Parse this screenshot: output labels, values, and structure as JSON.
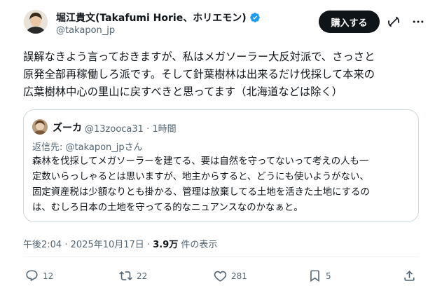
{
  "author": {
    "name": "堀江貴文(Takafumi Horie、ホリエモン)",
    "handle": "@takapon_jp",
    "subscribe_label": "購入する"
  },
  "post": {
    "lines": [
      "誤解なきよう言っておきますが、私はメガソーラー大反対派で、さっさと",
      "原発全部再稼働しろ派です。そして針葉樹林は出来るだけ伐採して本来の",
      "広葉樹林中心の里山に戻すべきと思ってます（北海道などは除く）"
    ]
  },
  "quote": {
    "name": "ズーカ",
    "handle": "@13zooca31",
    "separator": "·",
    "time": "1時間",
    "reply_prefix": "返信先: ",
    "reply_handle": "@takapon_jp",
    "reply_suffix": "さん",
    "lines": [
      "森林を伐採してメガソーラーを建てる、要は自然を守ってないって考えの人も一",
      "定数いらっしゃるとは思いますが、地主からすると、どうにも使いようがない、",
      "固定資産税は少額なりとも掛かる、管理は放棄してる土地を活きた土地にするの",
      "は、むしろ日本の土地を守ってる的なニュアンスなのかなぁと。"
    ]
  },
  "meta": {
    "time": "午後2:04",
    "separator": "·",
    "date": "2025年10月17日",
    "views": "3.9万",
    "views_label": " 件の表示"
  },
  "actions": {
    "replies": "12",
    "reposts": "22",
    "likes": "281",
    "bookmarks": "5"
  },
  "colors": {
    "text": "#0f1419",
    "secondary": "#536471",
    "verified": "#1d9bf0",
    "border": "#cfd9de",
    "button_bg": "#0f1419"
  }
}
